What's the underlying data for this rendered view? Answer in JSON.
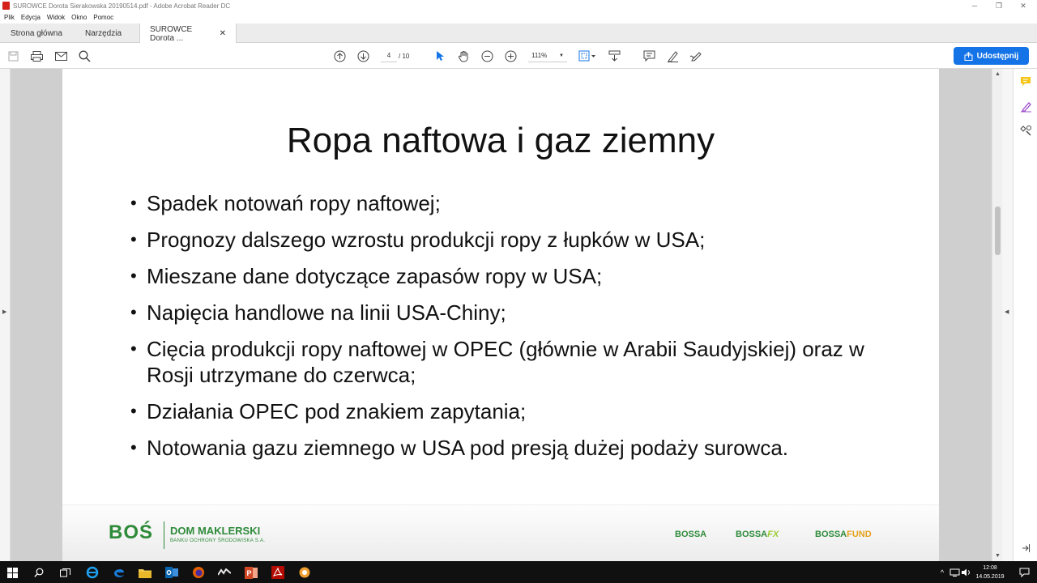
{
  "window": {
    "title": "SUROWCE Dorota Sierakowska 20190514.pdf - Adobe Acrobat Reader DC"
  },
  "menu": [
    "Plik",
    "Edycja",
    "Widok",
    "Okno",
    "Pomoc"
  ],
  "tabs": {
    "home": "Strona główna",
    "tools": "Narzędzia",
    "document": "SUROWCE Dorota ...",
    "close": "✕"
  },
  "toolbar": {
    "page_current": "4",
    "page_total": "/ 10",
    "zoom": "111%",
    "share_label": "Udostępnij"
  },
  "document": {
    "title": "Ropa naftowa i gaz ziemny",
    "bullets": [
      "Spadek notowań ropy naftowej;",
      "Prognozy dalszego wzrostu produkcji ropy z łupków w USA;",
      "Mieszane dane dotyczące zapasów ropy w USA;",
      "Napięcia handlowe na linii USA-Chiny;",
      "Cięcia produkcji ropy naftowej w OPEC (głównie w Arabii Saudyjskiej) oraz w Rosji utrzymane do czerwca;",
      "Działania OPEC pod znakiem zapytania;",
      "Notowania gazu ziemnego w USA pod presją dużej podaży surowca."
    ],
    "footer": {
      "logo": "BOŚ",
      "company": "DOM MAKLERSKI",
      "company_sub": "BANKU OCHRONY ŚRODOWISKA S.A.",
      "brand1": "BOSSA",
      "brand2_base": "BOSSA",
      "brand2_suffix": "FX",
      "brand3_base": "BOSSA",
      "brand3_suffix": "FUND"
    }
  },
  "taskbar": {
    "time": "12:08",
    "date": "14.05.2019"
  },
  "colors": {
    "accent": "#1473e6",
    "brand_green": "#2e8b3a"
  }
}
